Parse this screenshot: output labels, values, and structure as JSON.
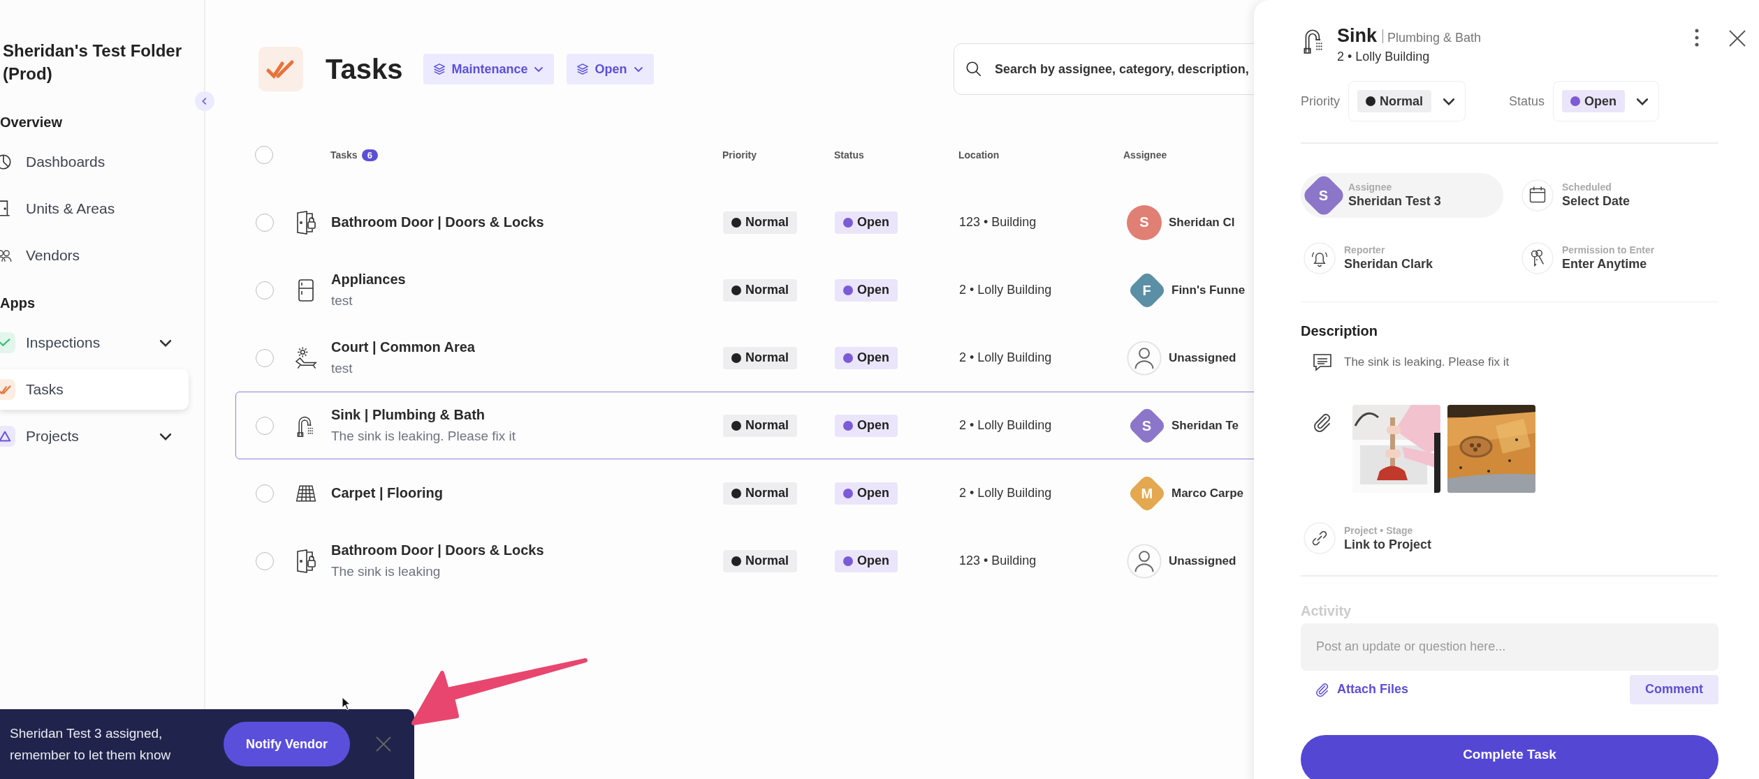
{
  "sidebar": {
    "title": "Sheridan's Test Folder (Prod)",
    "sections": [
      {
        "heading": "Overview",
        "items": [
          {
            "label": "Dashboards",
            "kind": "pie",
            "selected": false,
            "expandable": false
          },
          {
            "label": "Units & Areas",
            "kind": "door",
            "selected": false,
            "expandable": false
          },
          {
            "label": "Vendors",
            "kind": "people",
            "selected": false,
            "expandable": false
          }
        ]
      },
      {
        "heading": "Apps",
        "items": [
          {
            "label": "Inspections",
            "kind": "check",
            "selected": false,
            "expandable": true
          },
          {
            "label": "Tasks",
            "kind": "tasks",
            "selected": true,
            "expandable": false
          },
          {
            "label": "Projects",
            "kind": "triangle",
            "selected": false,
            "expandable": true
          }
        ]
      }
    ]
  },
  "header": {
    "title": "Tasks",
    "filters": [
      "Maintenance",
      "Open"
    ],
    "search": {
      "placeholder": "Search by assignee, category, description,"
    }
  },
  "table": {
    "columns": [
      "Tasks",
      "Priority",
      "Status",
      "Location",
      "Assignee"
    ],
    "count": "6",
    "all_selected": false,
    "rows": [
      {
        "kind": "door",
        "title": "Bathroom Door | Doors & Locks",
        "priority": "Normal",
        "status": "Open",
        "location": "123 • Building",
        "assignee": {
          "kind": "circle",
          "initial": "S",
          "color": "#e07f73",
          "name": "Sheridan Cl"
        },
        "selected": false
      },
      {
        "kind": "fridge",
        "title": "Appliances",
        "subtitle": "test",
        "priority": "Normal",
        "status": "Open",
        "location": "2 • Lolly Building",
        "assignee": {
          "kind": "diamond",
          "initial": "F",
          "color": "#5a8fa6",
          "name": "Finn's Funne"
        },
        "selected": false
      },
      {
        "kind": "lounger",
        "title": "Court | Common Area",
        "subtitle": "test",
        "priority": "Normal",
        "status": "Open",
        "location": "2 • Lolly Building",
        "assignee": {
          "kind": "none",
          "name": "Unassigned"
        },
        "selected": false
      },
      {
        "kind": "faucet",
        "title": "Sink | Plumbing & Bath",
        "subtitle": "The sink is leaking. Please fix it",
        "priority": "Normal",
        "status": "Open",
        "location": "2 • Lolly Building",
        "assignee": {
          "kind": "diamond",
          "initial": "S",
          "color": "#8c76c9",
          "name": "Sheridan Te"
        },
        "selected": true
      },
      {
        "kind": "floor",
        "title": "Carpet | Flooring",
        "priority": "Normal",
        "status": "Open",
        "location": "2 • Lolly Building",
        "assignee": {
          "kind": "diamond",
          "initial": "M",
          "color": "#e3a850",
          "name": "Marco Carpe"
        },
        "selected": false
      },
      {
        "kind": "door",
        "title": "Bathroom Door | Doors & Locks",
        "subtitle": "The sink is leaking",
        "priority": "Normal",
        "status": "Open",
        "location": "123 • Building",
        "assignee": {
          "kind": "none",
          "name": "Unassigned"
        },
        "selected": false
      }
    ]
  },
  "panel": {
    "title": "Sink",
    "category": "Plumbing & Bath",
    "location": "2 • Lolly Building",
    "priority_label": "Priority",
    "priority": "Normal",
    "status_label": "Status",
    "status": "Open",
    "fields": [
      {
        "kind": "avatar",
        "label": "Assignee",
        "value": "Sheridan Test 3",
        "initial": "S",
        "color": "#8c76c9"
      },
      {
        "kind": "calendar",
        "label": "Scheduled",
        "value": "Select Date"
      },
      {
        "kind": "bell",
        "label": "Reporter",
        "value": "Sheridan Clark"
      },
      {
        "kind": "keys",
        "label": "Permission to Enter",
        "value": "Enter Anytime"
      }
    ],
    "description_heading": "Description",
    "description": "The sink is leaking. Please fix it",
    "project": {
      "label": "Project • Stage",
      "value": "Link to Project"
    },
    "activity_heading": "Activity",
    "comment_placeholder": "Post an update or question here...",
    "attach_label": "Attach Files",
    "comment_button": "Comment",
    "complete_button": "Complete Task"
  },
  "toast": {
    "message": "Sheridan Test 3 assigned, remember to let them know",
    "action": "Notify Vendor"
  }
}
